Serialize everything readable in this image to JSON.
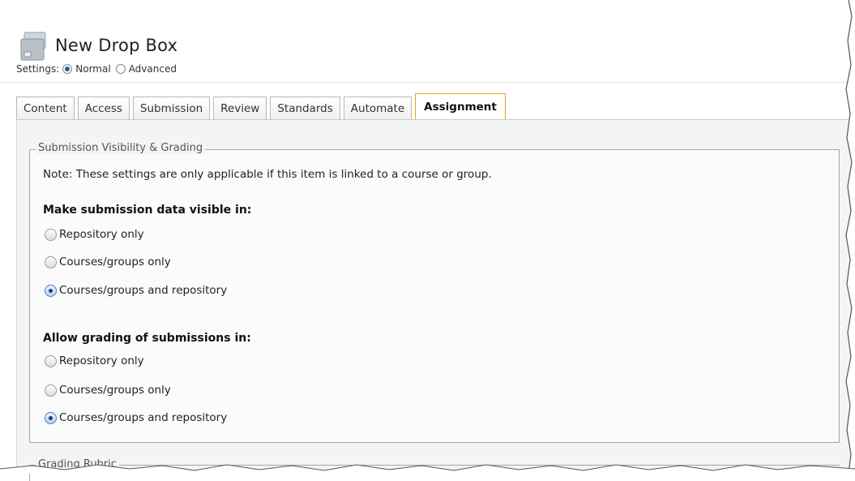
{
  "header": {
    "title": "New Drop Box",
    "icon": "dropbox-folder-icon"
  },
  "settings": {
    "label": "Settings:",
    "options": [
      {
        "label": "Normal",
        "selected": true
      },
      {
        "label": "Advanced",
        "selected": false
      }
    ]
  },
  "tabs": [
    {
      "label": "Content",
      "active": false
    },
    {
      "label": "Access",
      "active": false
    },
    {
      "label": "Submission",
      "active": false
    },
    {
      "label": "Review",
      "active": false
    },
    {
      "label": "Standards",
      "active": false
    },
    {
      "label": "Automate",
      "active": false
    },
    {
      "label": "Assignment",
      "active": true
    }
  ],
  "visibility_section": {
    "legend": "Submission Visibility & Grading",
    "note": "Note: These settings are only applicable if this item is linked to a course or group.",
    "visible_heading": "Make submission data visible in:",
    "visible_options": [
      {
        "label": "Repository only",
        "selected": false
      },
      {
        "label": "Courses/groups only",
        "selected": false
      },
      {
        "label": "Courses/groups and repository",
        "selected": true
      }
    ],
    "grading_heading": "Allow grading of submissions in:",
    "grading_options": [
      {
        "label": "Repository only",
        "selected": false
      },
      {
        "label": "Courses/groups only",
        "selected": false
      },
      {
        "label": "Courses/groups and repository",
        "selected": true
      }
    ]
  },
  "rubric_section": {
    "legend": "Grading Rubric"
  },
  "colors": {
    "active_tab_border": "#e3a424",
    "panel_background": "#f3f4f4",
    "radio_selected": "#4b7dc0"
  }
}
